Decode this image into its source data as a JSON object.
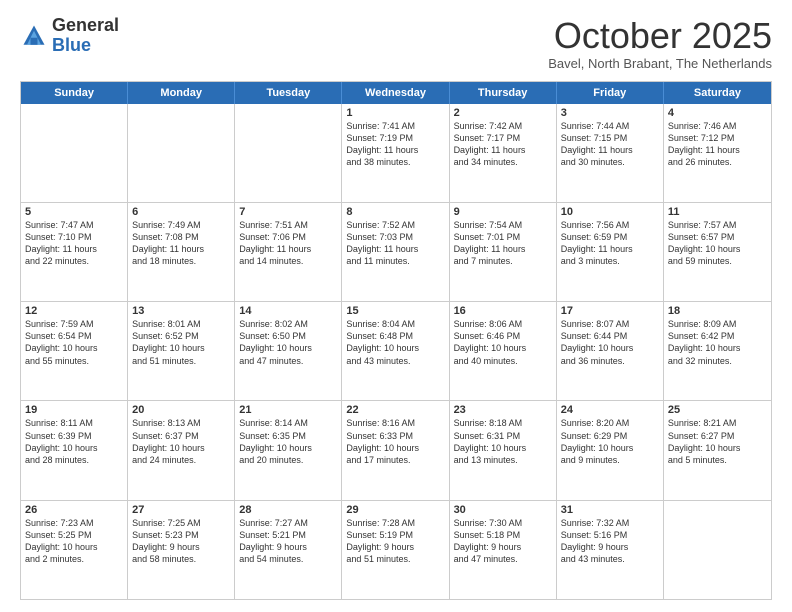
{
  "header": {
    "logo_general": "General",
    "logo_blue": "Blue",
    "month_title": "October 2025",
    "subtitle": "Bavel, North Brabant, The Netherlands"
  },
  "weekdays": [
    "Sunday",
    "Monday",
    "Tuesday",
    "Wednesday",
    "Thursday",
    "Friday",
    "Saturday"
  ],
  "rows": [
    [
      {
        "day": "",
        "text": ""
      },
      {
        "day": "",
        "text": ""
      },
      {
        "day": "",
        "text": ""
      },
      {
        "day": "1",
        "text": "Sunrise: 7:41 AM\nSunset: 7:19 PM\nDaylight: 11 hours\nand 38 minutes."
      },
      {
        "day": "2",
        "text": "Sunrise: 7:42 AM\nSunset: 7:17 PM\nDaylight: 11 hours\nand 34 minutes."
      },
      {
        "day": "3",
        "text": "Sunrise: 7:44 AM\nSunset: 7:15 PM\nDaylight: 11 hours\nand 30 minutes."
      },
      {
        "day": "4",
        "text": "Sunrise: 7:46 AM\nSunset: 7:12 PM\nDaylight: 11 hours\nand 26 minutes."
      }
    ],
    [
      {
        "day": "5",
        "text": "Sunrise: 7:47 AM\nSunset: 7:10 PM\nDaylight: 11 hours\nand 22 minutes."
      },
      {
        "day": "6",
        "text": "Sunrise: 7:49 AM\nSunset: 7:08 PM\nDaylight: 11 hours\nand 18 minutes."
      },
      {
        "day": "7",
        "text": "Sunrise: 7:51 AM\nSunset: 7:06 PM\nDaylight: 11 hours\nand 14 minutes."
      },
      {
        "day": "8",
        "text": "Sunrise: 7:52 AM\nSunset: 7:03 PM\nDaylight: 11 hours\nand 11 minutes."
      },
      {
        "day": "9",
        "text": "Sunrise: 7:54 AM\nSunset: 7:01 PM\nDaylight: 11 hours\nand 7 minutes."
      },
      {
        "day": "10",
        "text": "Sunrise: 7:56 AM\nSunset: 6:59 PM\nDaylight: 11 hours\nand 3 minutes."
      },
      {
        "day": "11",
        "text": "Sunrise: 7:57 AM\nSunset: 6:57 PM\nDaylight: 10 hours\nand 59 minutes."
      }
    ],
    [
      {
        "day": "12",
        "text": "Sunrise: 7:59 AM\nSunset: 6:54 PM\nDaylight: 10 hours\nand 55 minutes."
      },
      {
        "day": "13",
        "text": "Sunrise: 8:01 AM\nSunset: 6:52 PM\nDaylight: 10 hours\nand 51 minutes."
      },
      {
        "day": "14",
        "text": "Sunrise: 8:02 AM\nSunset: 6:50 PM\nDaylight: 10 hours\nand 47 minutes."
      },
      {
        "day": "15",
        "text": "Sunrise: 8:04 AM\nSunset: 6:48 PM\nDaylight: 10 hours\nand 43 minutes."
      },
      {
        "day": "16",
        "text": "Sunrise: 8:06 AM\nSunset: 6:46 PM\nDaylight: 10 hours\nand 40 minutes."
      },
      {
        "day": "17",
        "text": "Sunrise: 8:07 AM\nSunset: 6:44 PM\nDaylight: 10 hours\nand 36 minutes."
      },
      {
        "day": "18",
        "text": "Sunrise: 8:09 AM\nSunset: 6:42 PM\nDaylight: 10 hours\nand 32 minutes."
      }
    ],
    [
      {
        "day": "19",
        "text": "Sunrise: 8:11 AM\nSunset: 6:39 PM\nDaylight: 10 hours\nand 28 minutes."
      },
      {
        "day": "20",
        "text": "Sunrise: 8:13 AM\nSunset: 6:37 PM\nDaylight: 10 hours\nand 24 minutes."
      },
      {
        "day": "21",
        "text": "Sunrise: 8:14 AM\nSunset: 6:35 PM\nDaylight: 10 hours\nand 20 minutes."
      },
      {
        "day": "22",
        "text": "Sunrise: 8:16 AM\nSunset: 6:33 PM\nDaylight: 10 hours\nand 17 minutes."
      },
      {
        "day": "23",
        "text": "Sunrise: 8:18 AM\nSunset: 6:31 PM\nDaylight: 10 hours\nand 13 minutes."
      },
      {
        "day": "24",
        "text": "Sunrise: 8:20 AM\nSunset: 6:29 PM\nDaylight: 10 hours\nand 9 minutes."
      },
      {
        "day": "25",
        "text": "Sunrise: 8:21 AM\nSunset: 6:27 PM\nDaylight: 10 hours\nand 5 minutes."
      }
    ],
    [
      {
        "day": "26",
        "text": "Sunrise: 7:23 AM\nSunset: 5:25 PM\nDaylight: 10 hours\nand 2 minutes."
      },
      {
        "day": "27",
        "text": "Sunrise: 7:25 AM\nSunset: 5:23 PM\nDaylight: 9 hours\nand 58 minutes."
      },
      {
        "day": "28",
        "text": "Sunrise: 7:27 AM\nSunset: 5:21 PM\nDaylight: 9 hours\nand 54 minutes."
      },
      {
        "day": "29",
        "text": "Sunrise: 7:28 AM\nSunset: 5:19 PM\nDaylight: 9 hours\nand 51 minutes."
      },
      {
        "day": "30",
        "text": "Sunrise: 7:30 AM\nSunset: 5:18 PM\nDaylight: 9 hours\nand 47 minutes."
      },
      {
        "day": "31",
        "text": "Sunrise: 7:32 AM\nSunset: 5:16 PM\nDaylight: 9 hours\nand 43 minutes."
      },
      {
        "day": "",
        "text": ""
      }
    ]
  ]
}
